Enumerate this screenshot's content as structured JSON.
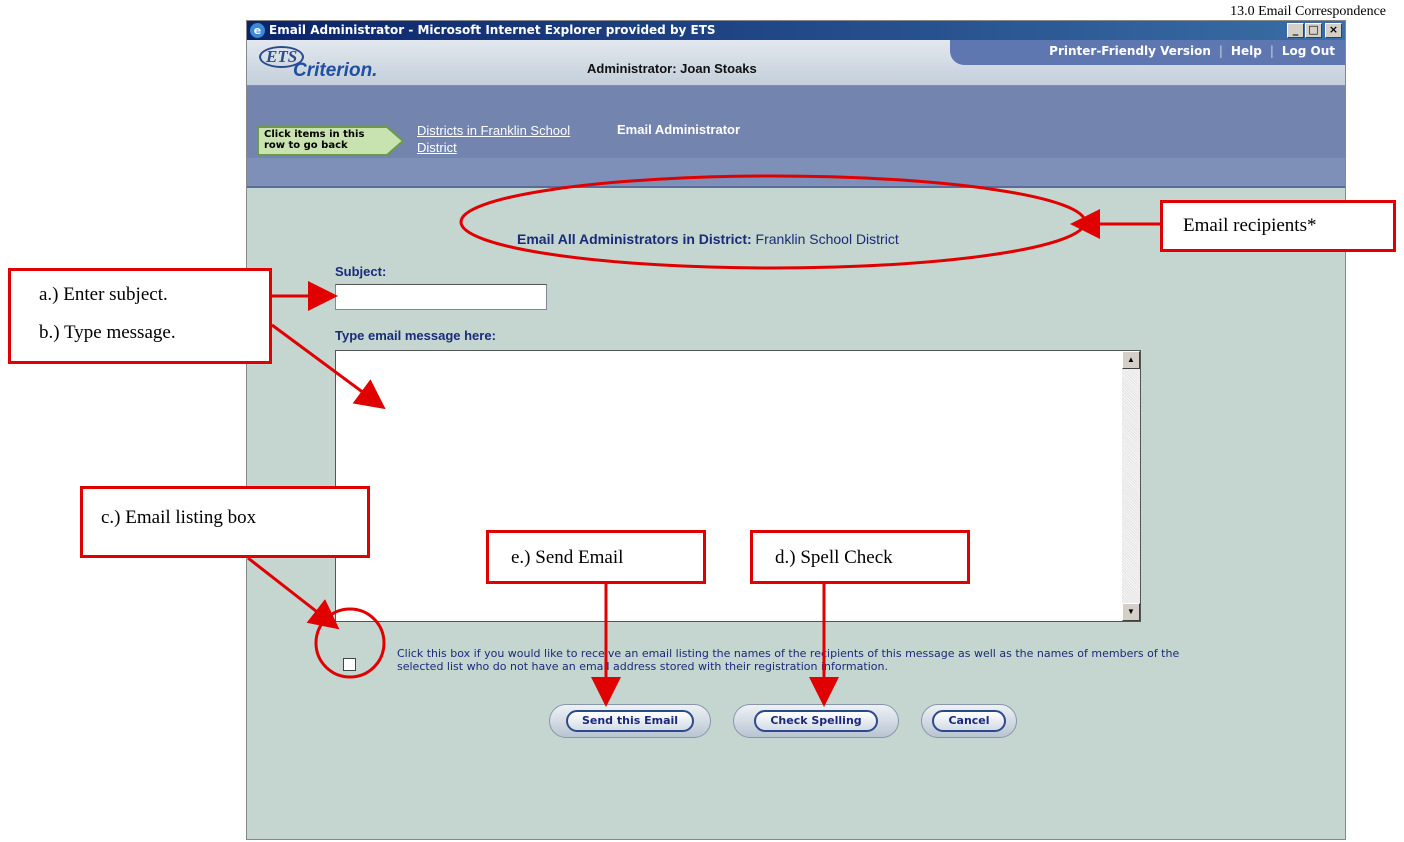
{
  "page_header": "13.0  Email Correspondence",
  "window": {
    "title": "Email Administrator - Microsoft Internet Explorer provided by ETS",
    "min_btn": "_",
    "max_btn": "□",
    "close_btn": "×"
  },
  "header": {
    "logo_ets": "ETS",
    "logo_criterion": "Criterion.",
    "admin_label": "Administrator: Joan Stoaks",
    "links": {
      "printer": "Printer-Friendly Version",
      "sep1": "|",
      "help": "Help",
      "sep2": "|",
      "logout": "Log Out"
    }
  },
  "nav": {
    "back_hint_line1": "Click items in this",
    "back_hint_line2": "row to go back",
    "crumb_link": "Districts in Franklin School District",
    "crumb_current": "Email Administrator"
  },
  "form": {
    "recipients_label": "Email All Administrators in District:",
    "recipients_value": " Franklin School District",
    "subject_label": "Subject:",
    "subject_value": "",
    "message_label": "Type email message here:",
    "message_value": "",
    "checkbox_label": "Click this box if you would like to receive an email listing the names of the recipients of this message as well as the names of members of the selected list who do not have an email address stored with their registration information.",
    "checkbox_checked": false,
    "send_button": "Send this Email",
    "spell_button": "Check Spelling",
    "cancel_button": "Cancel"
  },
  "annotations": {
    "recipients": "Email recipients*",
    "subject_a": "a.)  Enter subject.",
    "subject_b": "b.)  Type message.",
    "listing": "c.) Email listing box",
    "send": "e.) Send Email",
    "spell": "d.) Spell Check",
    "color": "#e00000"
  }
}
